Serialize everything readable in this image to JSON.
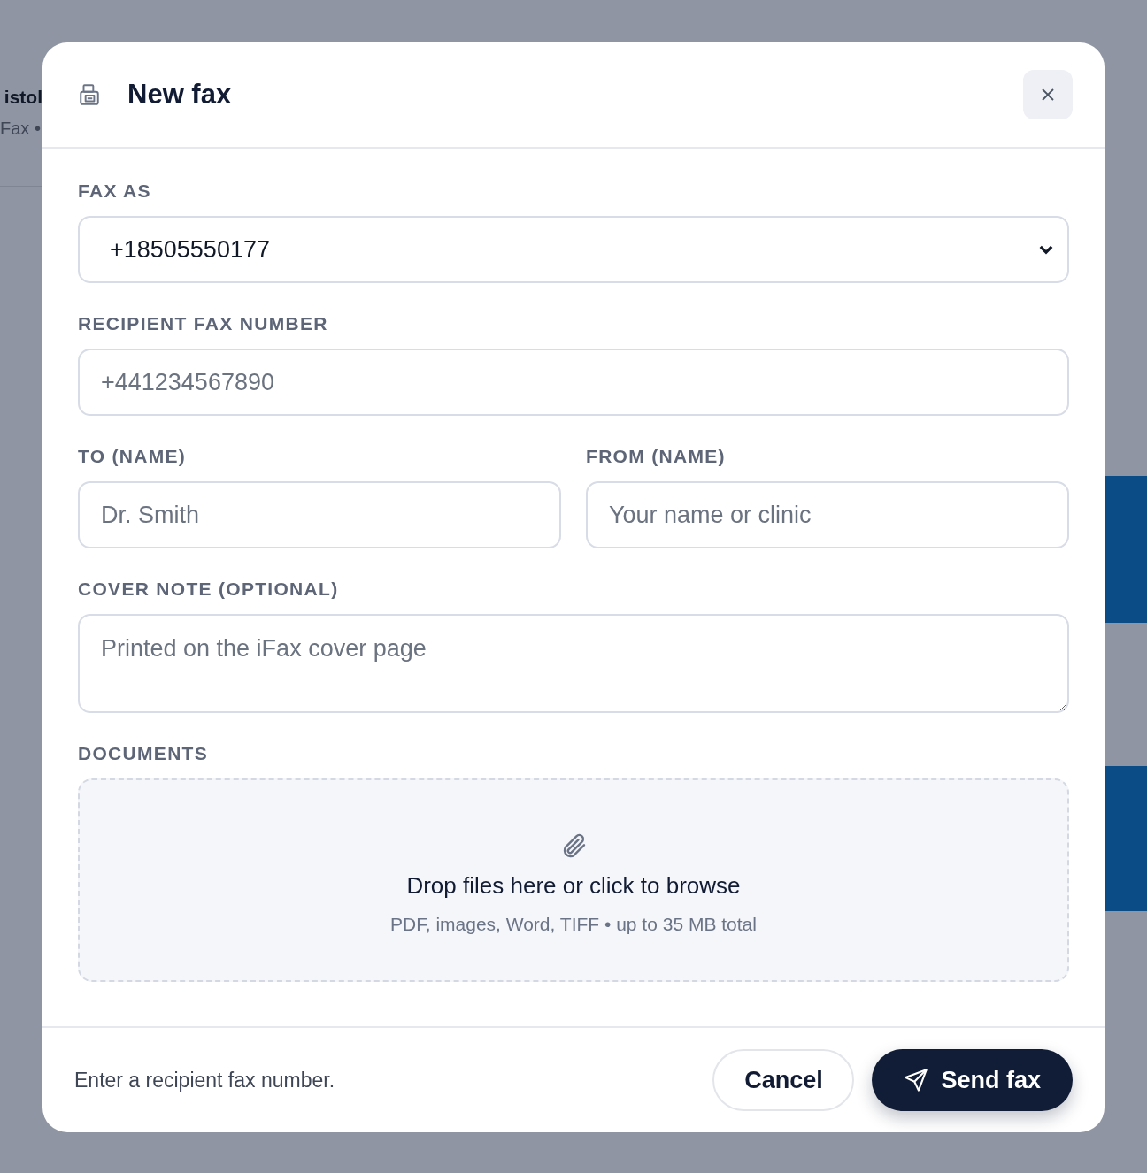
{
  "backdrop": {
    "heading": "istol",
    "subheading": "Fax •"
  },
  "dialog": {
    "title": "New fax",
    "fields": [
      {
        "kind": "select",
        "label": "FAX AS",
        "value": "+18505550177"
      },
      {
        "kind": "input",
        "label": "RECIPIENT FAX NUMBER",
        "placeholder": "+441234567890"
      },
      {
        "kind": "pair",
        "items": [
          {
            "label": "TO (NAME)",
            "placeholder": "Dr. Smith"
          },
          {
            "label": "FROM (NAME)",
            "placeholder": "Your name or clinic"
          }
        ]
      },
      {
        "kind": "textarea",
        "label": "COVER NOTE (OPTIONAL)",
        "placeholder": "Printed on the iFax cover page"
      },
      {
        "kind": "dropzone",
        "label": "DOCUMENTS",
        "text": "Drop files here or click to browse",
        "hint": "PDF, images, Word, TIFF • up to 35 MB total"
      }
    ],
    "footer": {
      "message": "Enter a recipient fax number.",
      "buttons": [
        {
          "kind": "secondary",
          "label": "Cancel"
        },
        {
          "kind": "primary",
          "label": "Send fax"
        }
      ]
    }
  }
}
